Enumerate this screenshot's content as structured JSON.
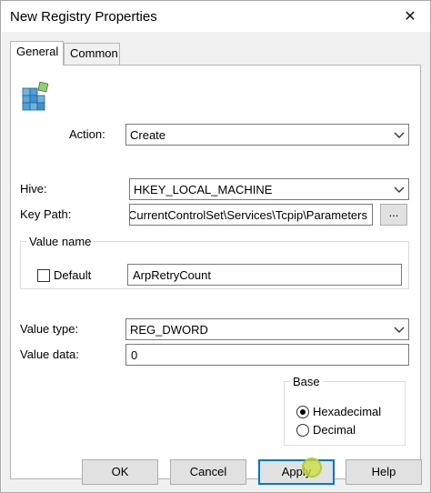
{
  "window": {
    "title": "New Registry Properties",
    "close_glyph": "✕"
  },
  "tabs": [
    {
      "label": "General",
      "selected": true
    },
    {
      "label": "Common",
      "selected": false
    }
  ],
  "general": {
    "action_label": "Action:",
    "action_value": "Create",
    "hive_label": "Hive:",
    "hive_value": "HKEY_LOCAL_MACHINE",
    "keypath_label": "Key Path:",
    "keypath_value": "CurrentControlSet\\Services\\Tcpip\\Parameters",
    "browse_label": "...",
    "value_name_group": "Value name",
    "default_label": "Default",
    "default_checked": false,
    "value_name_value": "ArpRetryCount",
    "value_type_label": "Value type:",
    "value_type_value": "REG_DWORD",
    "value_data_label": "Value data:",
    "value_data_value": "0",
    "base_group": "Base",
    "base_options": [
      {
        "label": "Hexadecimal",
        "selected": true
      },
      {
        "label": "Decimal",
        "selected": false
      }
    ]
  },
  "buttons": {
    "ok": "OK",
    "cancel": "Cancel",
    "apply": "Apply",
    "help": "Help"
  },
  "icons": {
    "registry": "registry-cubes-icon",
    "dropdown": "chevron-down-icon",
    "close": "close-icon"
  },
  "colors": {
    "dialog_bg": "#f0f0f0",
    "panel_bg": "#ffffff",
    "accent": "#0078d7",
    "cursor_highlight": "#cddc39"
  }
}
